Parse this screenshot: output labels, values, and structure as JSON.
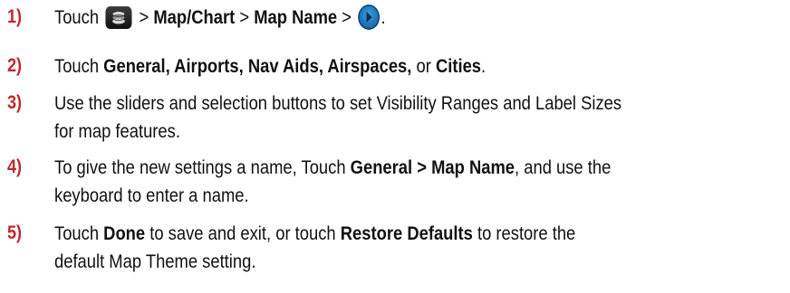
{
  "steps": [
    {
      "num": "1)",
      "t1": "Touch",
      "icon1": "map-layers-icon",
      "sep1": ">",
      "b1": "Map/Chart",
      "sep2": ">",
      "b2": "Map Name",
      "sep3": ">",
      "icon2": "go-arrow-icon",
      "end": "."
    },
    {
      "num": "2)",
      "t1": "Touch",
      "b1": "General, Airports, Nav Aids, Airspaces,",
      "t2": "or",
      "b2": "Cities",
      "end": "."
    },
    {
      "num": "3)",
      "line1": "Use the sliders and selection buttons to set Visibility Ranges and Label Sizes",
      "line2": "for map features."
    },
    {
      "num": "4)",
      "t1": "To give the new settings a name, Touch",
      "b1": "General > Map Name",
      "t2": ", and use the",
      "line2": "keyboard to enter a name."
    },
    {
      "num": "5)",
      "t1": "Touch",
      "b1": "Done",
      "t2": "to save and exit, or touch",
      "b2": "Restore Defaults",
      "t3": "to restore the",
      "line2": "default Map Theme setting."
    }
  ]
}
